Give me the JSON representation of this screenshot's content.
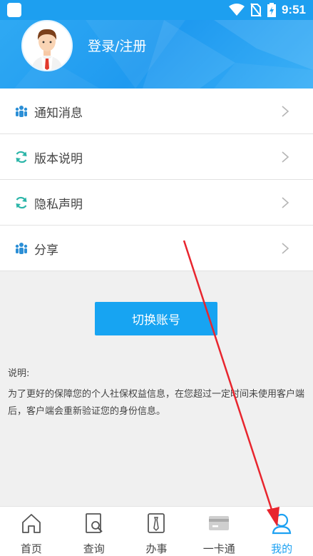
{
  "status_bar": {
    "time": "9:51"
  },
  "header": {
    "login_label": "登录/注册"
  },
  "menu": {
    "items": [
      {
        "label": "通知消息",
        "icon": "people-icon"
      },
      {
        "label": "版本说明",
        "icon": "refresh-icon"
      },
      {
        "label": "隐私声明",
        "icon": "refresh-icon"
      },
      {
        "label": "分享",
        "icon": "people-icon"
      }
    ]
  },
  "switch_account": {
    "label": "切换账号"
  },
  "note": {
    "title": "说明:",
    "body": "为了更好的保障您的个人社保权益信息，在您超过一定时间未使用客户端后，客户端会重新验证您的身份信息。"
  },
  "bottom_nav": {
    "tabs": [
      {
        "label": "首页",
        "icon": "home-icon"
      },
      {
        "label": "查询",
        "icon": "search-doc-icon"
      },
      {
        "label": "办事",
        "icon": "tie-icon"
      },
      {
        "label": "一卡通",
        "icon": "card-icon"
      },
      {
        "label": "我的",
        "icon": "profile-icon"
      }
    ],
    "active_tab": "我的"
  },
  "colors": {
    "accent": "#1da1f2",
    "annotation_arrow": "#e8252e"
  }
}
